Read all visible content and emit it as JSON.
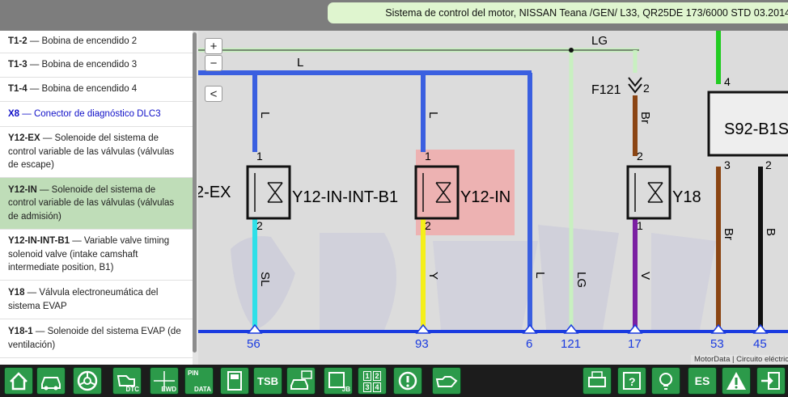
{
  "header": {
    "title": "Sistema de control del motor, NISSAN Teana /GEN/ L33, QR25DE 173/6000 STD 03.2014"
  },
  "sidebar": {
    "items": [
      {
        "code": "T1-2",
        "desc": " — Bobina de encendido 2"
      },
      {
        "code": "T1-3",
        "desc": " — Bobina de encendido 3"
      },
      {
        "code": "T1-4",
        "desc": " — Bobina de encendido 4"
      },
      {
        "code": "X8",
        "desc": " — Conector de diagnóstico DLC3"
      },
      {
        "code": "Y12-EX",
        "desc": " — Solenoide del sistema de control variable de las válvulas (válvulas de escape)"
      },
      {
        "code": "Y12-IN",
        "desc": " — Solenoide del sistema de control variable de las válvulas (válvulas de admisión)"
      },
      {
        "code": "Y12-IN-INT-B1",
        "desc": " — Variable valve timing solenoid valve (intake camshaft intermediate position, B1)"
      },
      {
        "code": "Y18",
        "desc": " — Válvula electroneumática del sistema EVAP"
      },
      {
        "code": "Y18-1",
        "desc": " — Solenoide del sistema EVAP (de ventilación)"
      }
    ]
  },
  "controls": {
    "zoom_in": "+",
    "zoom_out": "−",
    "collapse": "<"
  },
  "diagram": {
    "wire_L_top": "L",
    "wire_LG_top": "LG",
    "connector_f121": "F121",
    "f121_pin": "2",
    "comp_y12ex_partial": "2-EX",
    "comp_y12_in_int_b1": "Y12-IN-INT-B1",
    "comp_y12_in": "Y12-IN",
    "comp_y18": "Y18",
    "comp_s92": "S92-B1S",
    "s92_pin4": "4",
    "s92_pin3": "3",
    "s92_pin2": "2",
    "pin1": "1",
    "pin2": "2",
    "wire_L": "L",
    "wire_Br": "Br",
    "wire_SL": "SL",
    "wire_Y": "Y",
    "wire_V": "V",
    "wire_LG": "LG",
    "wire_B": "B",
    "term_56": "56",
    "term_93": "93",
    "term_6": "6",
    "term_121": "121",
    "term_17": "17",
    "term_53": "53",
    "term_45": "45",
    "credit": "MotorData | Circuito eléctrico"
  },
  "toolbar": {
    "dtc_label": "DTC",
    "ewd_label": "EWD",
    "pin_label": "PIN",
    "data_label": "DATA",
    "tsb_label": "TSB",
    "jb_label": "JB",
    "num_1": "1",
    "num_2": "2",
    "num_3": "3",
    "num_4": "4",
    "lang_label": "ES"
  },
  "colors": {
    "accent_green": "#2c9a4a",
    "selected_row": "#bfddb8",
    "title_bar": "#dff5cf",
    "highlight": "#f0aaaa",
    "wire_blue": "#3a5fe0",
    "wire_light_blue": "#2ee0e8",
    "wire_yellow": "#f4ef1a",
    "wire_brown": "#8b4513",
    "wire_violet": "#7b1fa2",
    "wire_light_green": "#c8f0c0",
    "wire_green": "#22cc22"
  }
}
